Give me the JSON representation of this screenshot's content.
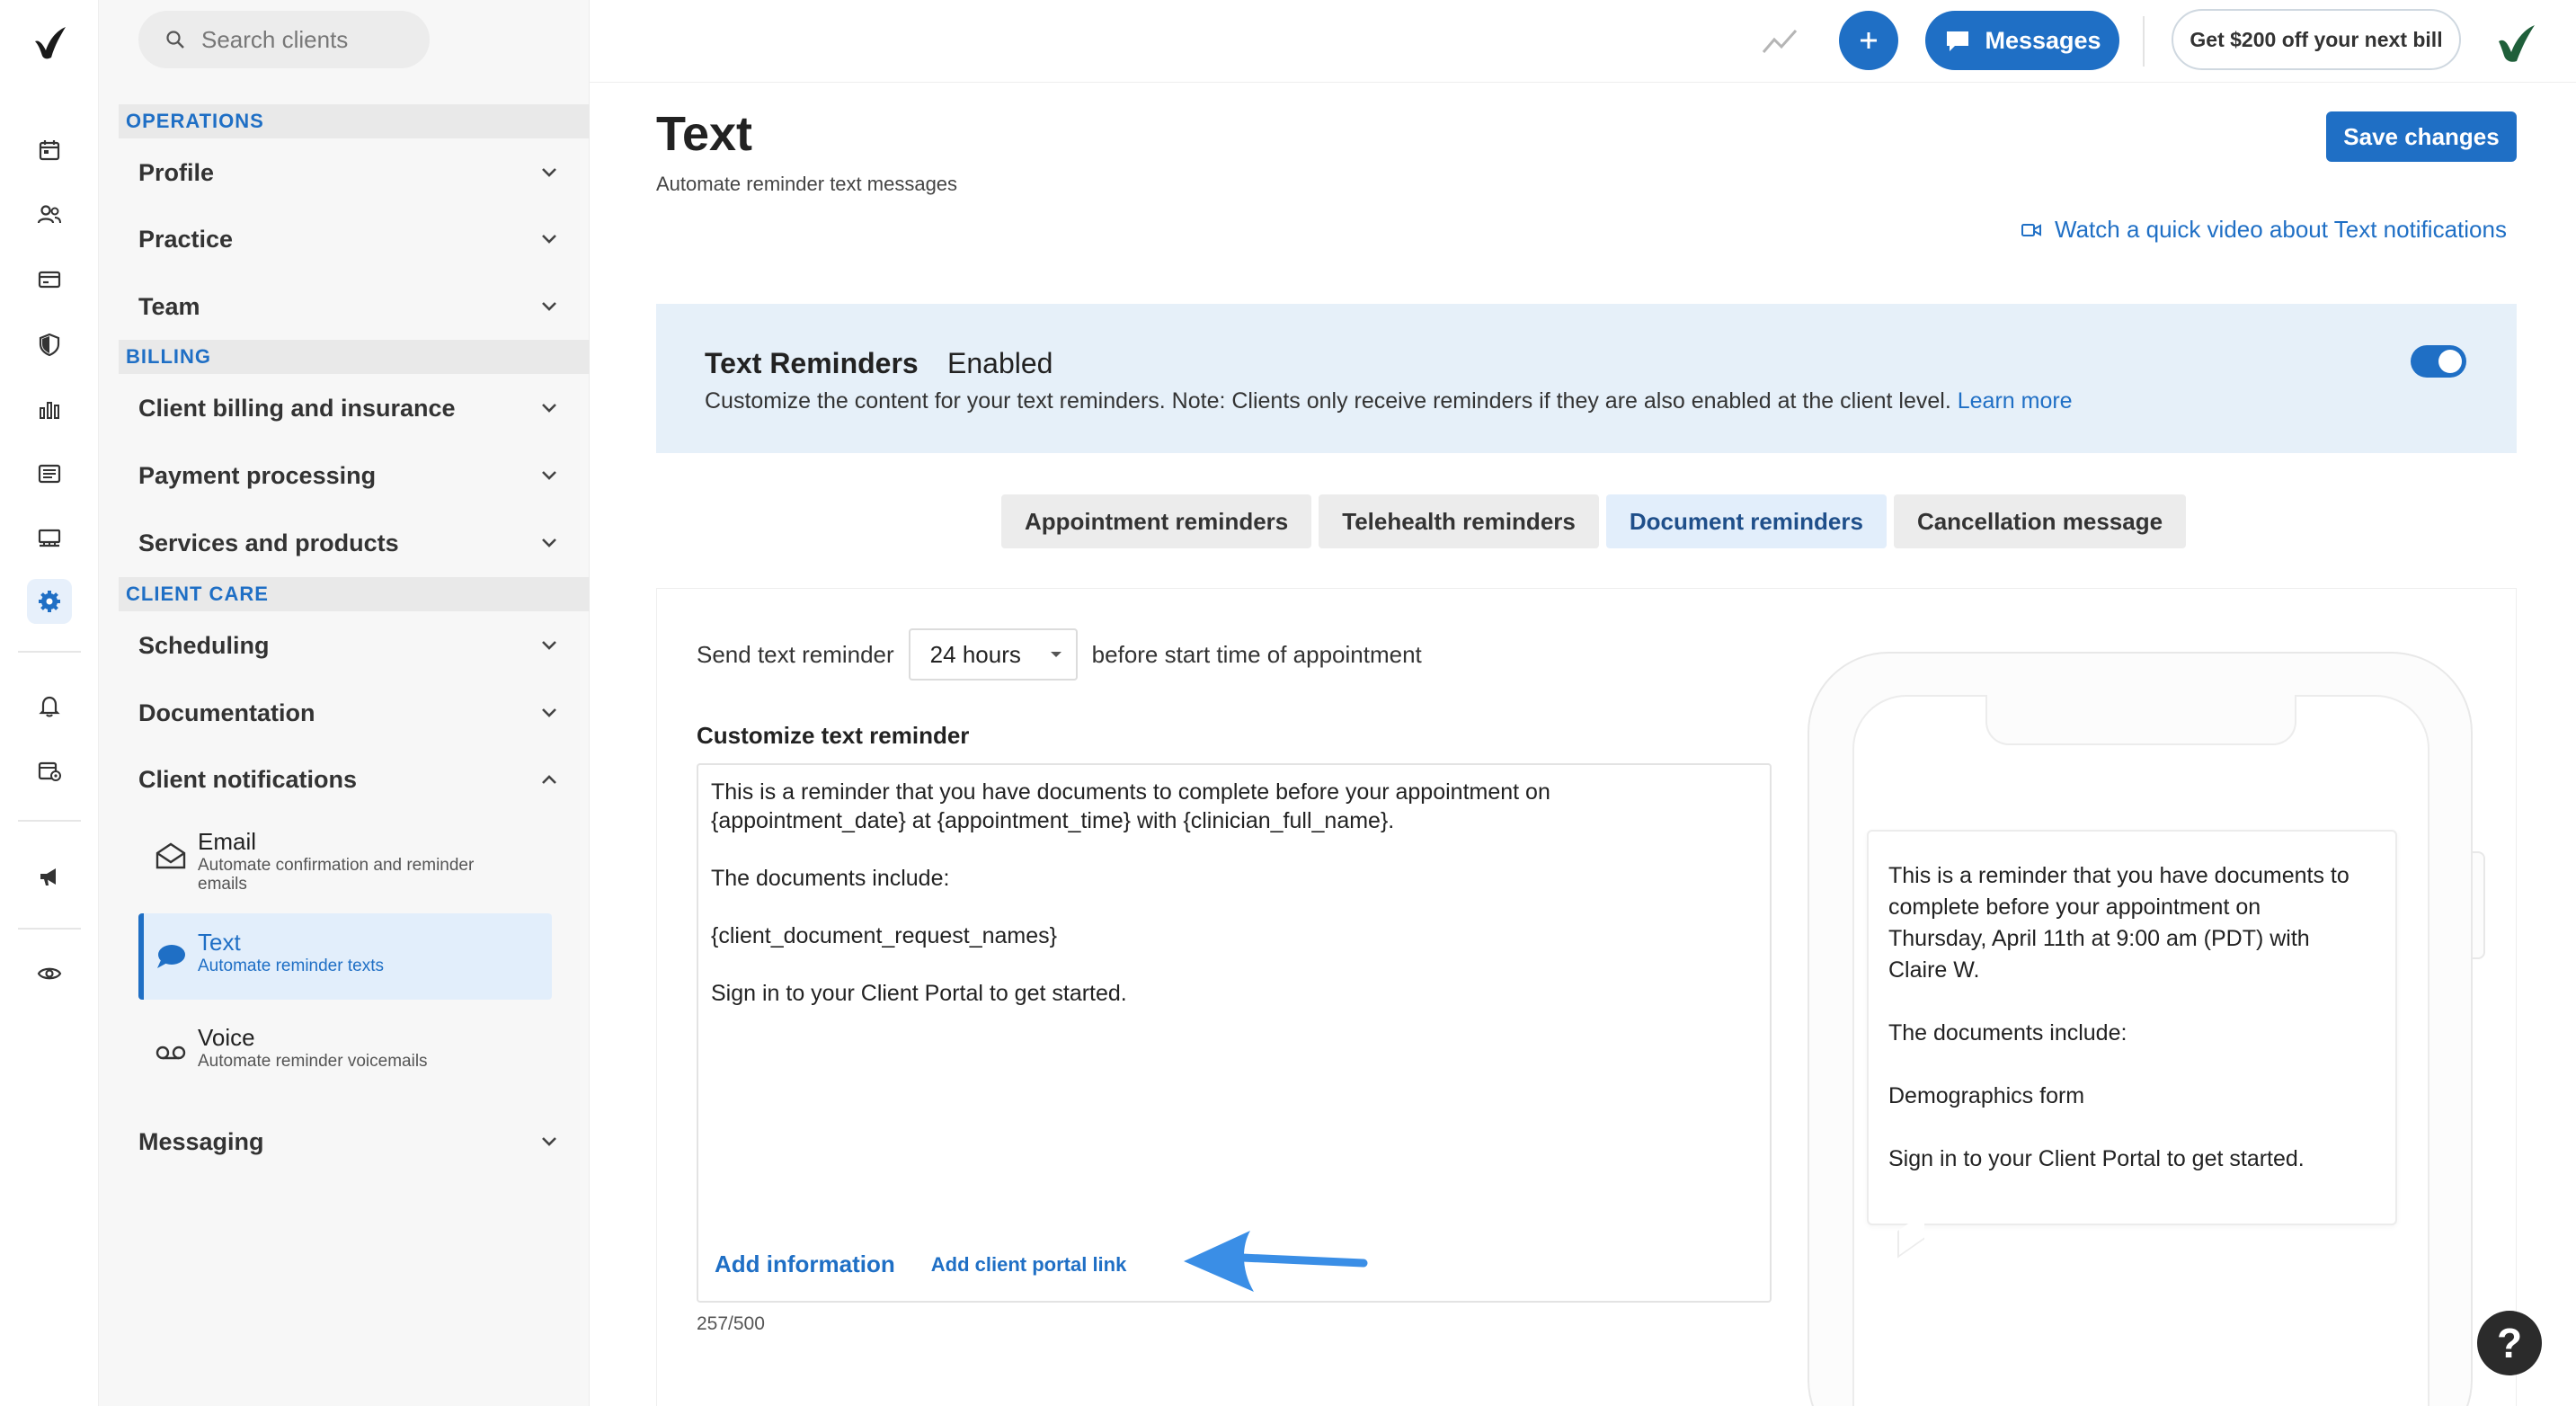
{
  "search": {
    "placeholder": "Search clients"
  },
  "sidebar": {
    "sections": [
      {
        "heading": "OPERATIONS",
        "items": [
          "Profile",
          "Practice",
          "Team"
        ]
      },
      {
        "heading": "BILLING",
        "items": [
          "Client billing and insurance",
          "Payment processing",
          "Services and products"
        ]
      },
      {
        "heading": "CLIENT CARE",
        "items": [
          "Scheduling",
          "Documentation",
          "Client notifications"
        ]
      }
    ],
    "notifications": [
      {
        "title": "Email",
        "desc": "Automate confirmation and reminder emails"
      },
      {
        "title": "Text",
        "desc": "Automate reminder texts"
      },
      {
        "title": "Voice",
        "desc": "Automate reminder voicemails"
      }
    ],
    "messaging": "Messaging"
  },
  "topbar": {
    "messages_label": "Messages",
    "promo_label": "Get $200 off your next bill"
  },
  "page": {
    "title": "Text",
    "subtitle": "Automate reminder text messages",
    "save_label": "Save changes",
    "video_link": "Watch a quick video about Text notifications"
  },
  "banner": {
    "title": "Text Reminders",
    "status": "Enabled",
    "desc": "Customize the content for your text reminders. Note: Clients only receive reminders if they are also enabled at the client level.",
    "learn_more": "Learn more",
    "enabled": true
  },
  "tabs": [
    "Appointment reminders",
    "Telehealth reminders",
    "Document reminders",
    "Cancellation message"
  ],
  "active_tab": "Document reminders",
  "reminder": {
    "send_prefix": "Send text reminder",
    "selected_time": "24 hours",
    "send_suffix": "before start time of appointment",
    "customize_label": "Customize text reminder",
    "template": "This is a reminder that you have documents to complete before your appointment on\n{appointment_date} at {appointment_time} with {clinician_full_name}.\n\nThe documents include:\n\n{client_document_request_names}\n\nSign in to your Client Portal to get started.",
    "add_information": "Add information",
    "add_portal_link": "Add client portal link",
    "counter": "257/500"
  },
  "preview": {
    "message": "This is a reminder that you have documents to\ncomplete before your appointment on\nThursday, April 11th at 9:00 am (PDT) with\nClaire W.\n\nThe documents include:\n\nDemographics form\n\nSign in to your Client Portal to get started."
  },
  "help_label": "?",
  "colors": {
    "accent": "#1f6fc5",
    "banner_bg": "#e6f0f9",
    "arrow": "#3a8ee6"
  },
  "rail_icons": [
    "calendar-icon",
    "clients-icon",
    "billing-card-icon",
    "insurance-shield-icon",
    "analytics-icon",
    "documents-list-icon",
    "marketplace-icon",
    "settings-gear-icon",
    "notifications-bell-icon",
    "calendar-settings-icon",
    "announcements-megaphone-icon",
    "visibility-eye-icon"
  ]
}
